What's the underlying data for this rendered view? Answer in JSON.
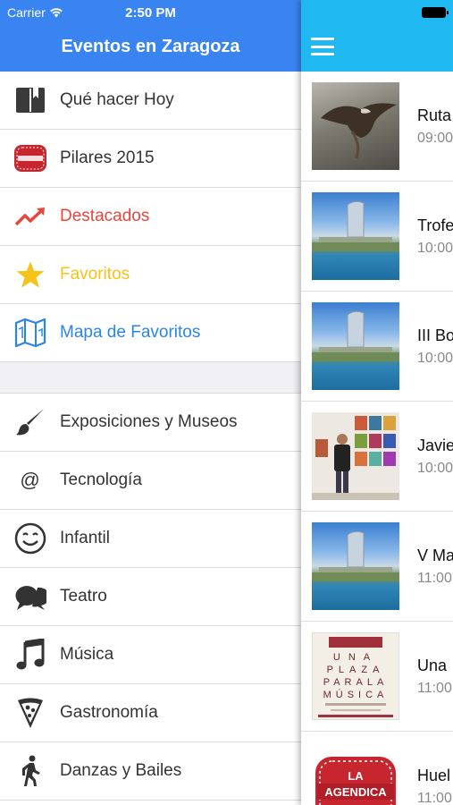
{
  "status": {
    "carrier": "Carrier",
    "time": "2:50 PM"
  },
  "drawer": {
    "title": "Eventos en Zaragoza",
    "top_items": [
      {
        "label": "Qué hacer Hoy",
        "icon": "book-icon"
      },
      {
        "label": "Pilares 2015",
        "icon": "la-agendica-logo"
      },
      {
        "label": "Destacados",
        "icon": "trending-up-icon",
        "color": "#e8463c"
      },
      {
        "label": "Favoritos",
        "icon": "star-icon",
        "color": "#f5c31a"
      },
      {
        "label": "Mapa de Favoritos",
        "icon": "map-icon",
        "color": "#2a85e8"
      }
    ],
    "category_items": [
      {
        "label": "Exposiciones y Museos",
        "icon": "paintbrush-icon"
      },
      {
        "label": "Tecnología",
        "icon": "at-icon",
        "glyph": "@"
      },
      {
        "label": "Infantil",
        "icon": "smiley-icon"
      },
      {
        "label": "Teatro",
        "icon": "speech-bubbles-icon"
      },
      {
        "label": "Música",
        "icon": "music-note-icon"
      },
      {
        "label": "Gastronomía",
        "icon": "pizza-slice-icon"
      },
      {
        "label": "Danzas y Bailes",
        "icon": "walking-person-icon"
      }
    ]
  },
  "events": [
    {
      "title": "Ruta",
      "time": "09:00",
      "thumb": "bird-photo"
    },
    {
      "title": "Trofe",
      "time": "10:00",
      "thumb": "tower-photo"
    },
    {
      "title": "III Bo",
      "time": "10:00",
      "thumb": "tower-photo"
    },
    {
      "title": "Javie",
      "time": "10:00",
      "thumb": "art-exhibit-photo"
    },
    {
      "title": "V Ma",
      "time": "11:00",
      "thumb": "tower-photo"
    },
    {
      "title": "Una",
      "time": "11:00",
      "thumb": "plaza-poster"
    },
    {
      "title": "Huel",
      "time": "11:00",
      "thumb": "la-agendica-logo"
    }
  ],
  "poster_text": "UNA PLAZA PARA LA MÚSICA",
  "logo_text": {
    "line1": "LA",
    "line2": "AGENDICA"
  },
  "colors": {
    "drawer_header": "#3a84f2",
    "right_header": "#1fb8f0",
    "destacados": "#e8463c",
    "favoritos": "#f5c31a",
    "mapa": "#2a85e8"
  }
}
